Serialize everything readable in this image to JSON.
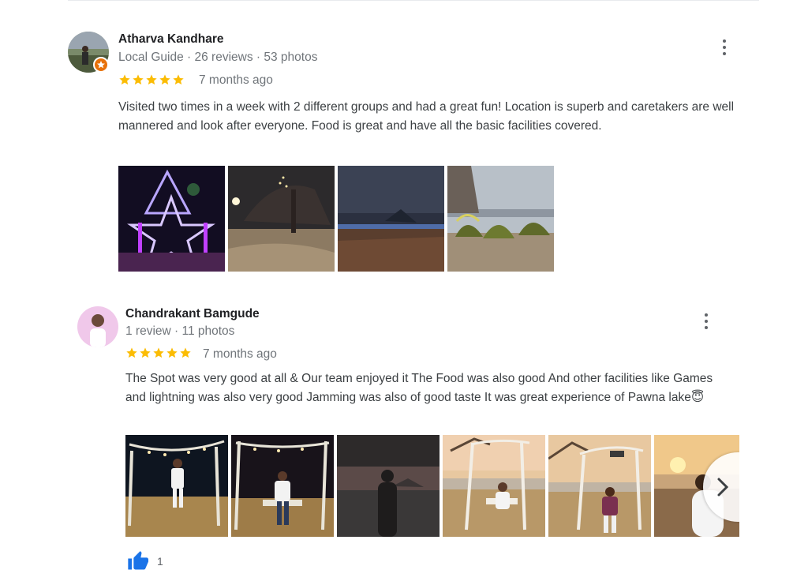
{
  "reviews": [
    {
      "name": "Atharva Kandhare",
      "meta": "Local Guide · 26 reviews · 53 photos",
      "rating": 5,
      "time": "7 months ago",
      "text": "Visited two times in a week with 2 different groups and had a great fun! Location is superb and caretakers are well mannered and look after everyone. Food is great and have all the basic facilities covered."
    },
    {
      "name": "Chandrakant Bamgude",
      "meta": "1 review · 11 photos",
      "rating": 5,
      "time": "7 months ago",
      "text": "The Spot was very good at all & Our team enjoyed it The Food was also good And other facilities like Games and lightning was also very good Jamming was also of good taste It was great experience of Pawna lake😇",
      "likes": "1"
    }
  ],
  "icons": {
    "star": "star-icon",
    "more": "more-vertical-icon",
    "next": "chevron-right-icon",
    "like": "thumbs-up-icon",
    "local_guide_badge": "local-guide-badge-icon"
  },
  "colors": {
    "star": "#fbbc04",
    "like": "#1a73e8",
    "badge": "#e8710a"
  }
}
